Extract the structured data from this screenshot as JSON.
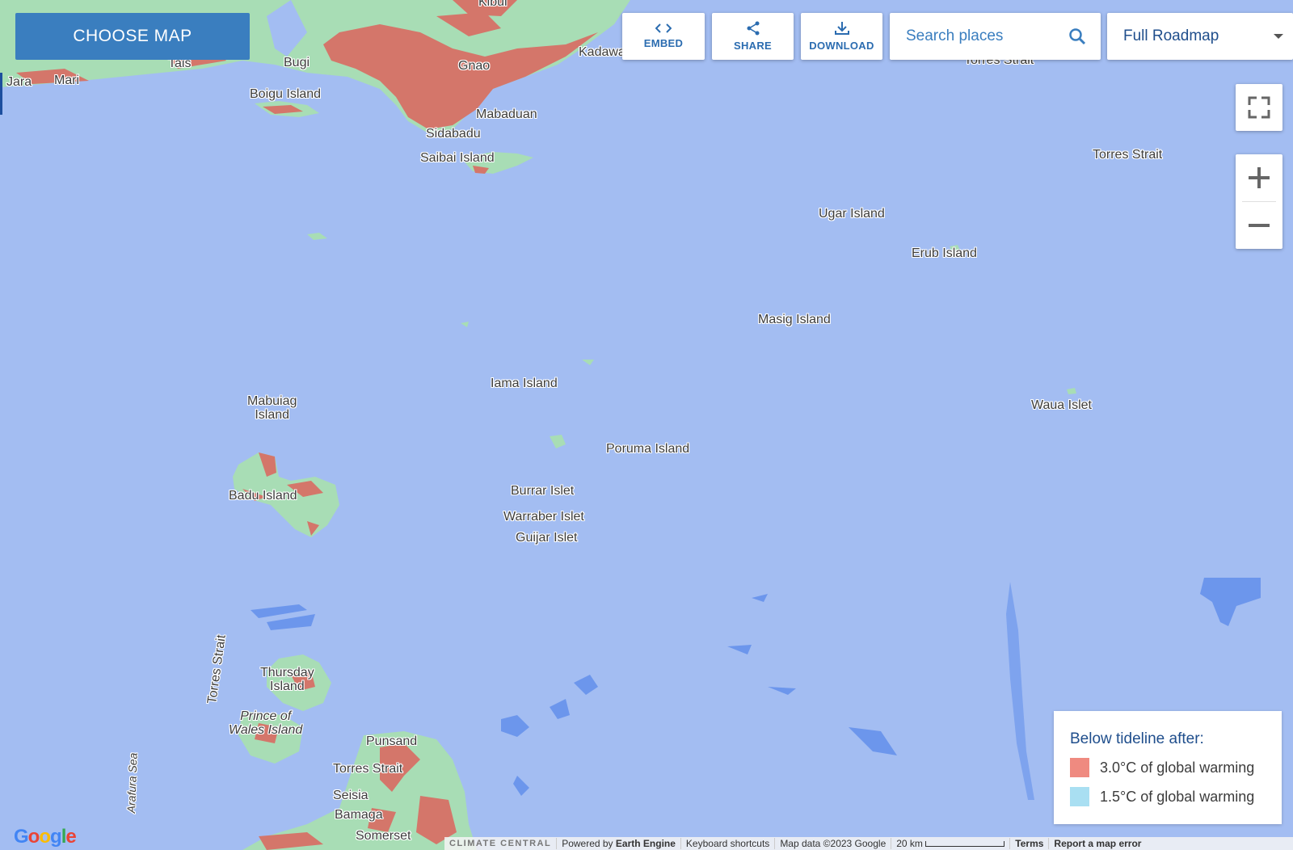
{
  "toolbar": {
    "choose_map": "CHOOSE MAP",
    "embed": "EMBED",
    "share": "SHARE",
    "download": "DOWNLOAD",
    "search_placeholder": "Search places",
    "map_type": "Full Roadmap"
  },
  "legend": {
    "title": "Below tideline after:",
    "items": [
      {
        "label": "3.0°C of global warming",
        "color": "#ef8a80"
      },
      {
        "label": "1.5°C of global warming",
        "color": "#a9dff2"
      }
    ]
  },
  "colors": {
    "water": "#a3bdf2",
    "land": "#a8ddb5",
    "flood_3c": "#d4766a",
    "reef": "#6c96ec",
    "accent": "#3a7ebf"
  },
  "places": {
    "kibul": "Kibul",
    "tais": "Tais",
    "bugi": "Bugi",
    "gnao": "Gnao",
    "kadawa": "Kadawa",
    "jara": "Jara",
    "mari": "Mari",
    "boigu": "Boigu Island",
    "mabaduan": "Mabaduan",
    "sidabadu": "Sidabadu",
    "saibai": "Saibai Island",
    "torres_strait_top": "Torres Strait",
    "torres_strait_right": "Torres Strait",
    "ugar": "Ugar Island",
    "erub": "Erub Island",
    "masig": "Masig Island",
    "iama": "Iama Island",
    "mabuiag": "Mabuiag\nIsland",
    "poruma": "Poruma Island",
    "waua": "Waua Islet",
    "badu": "Badu Island",
    "burrar": "Burrar Islet",
    "warraber": "Warraber Islet",
    "guijar": "Guijar Islet",
    "torres_strait_vertical": "Torres Strait",
    "thursday": "Thursday\nIsland",
    "prince_wales": "Prince of\nWales Island",
    "punsand": "Punsand",
    "torres_strait_bottom": "Torres Strait",
    "seisia": "Seisia",
    "bamaga": "Bamaga",
    "somerset": "Somerset",
    "arafura": "Arafura Sea"
  },
  "footer": {
    "brand": "CLIMATE CENTRAL",
    "powered": "Powered by",
    "engine": "Earth Engine",
    "shortcuts": "Keyboard shortcuts",
    "mapdata": "Map data ©2023 Google",
    "scale": "20 km",
    "terms": "Terms",
    "report": "Report a map error"
  },
  "google_logo": "Google"
}
